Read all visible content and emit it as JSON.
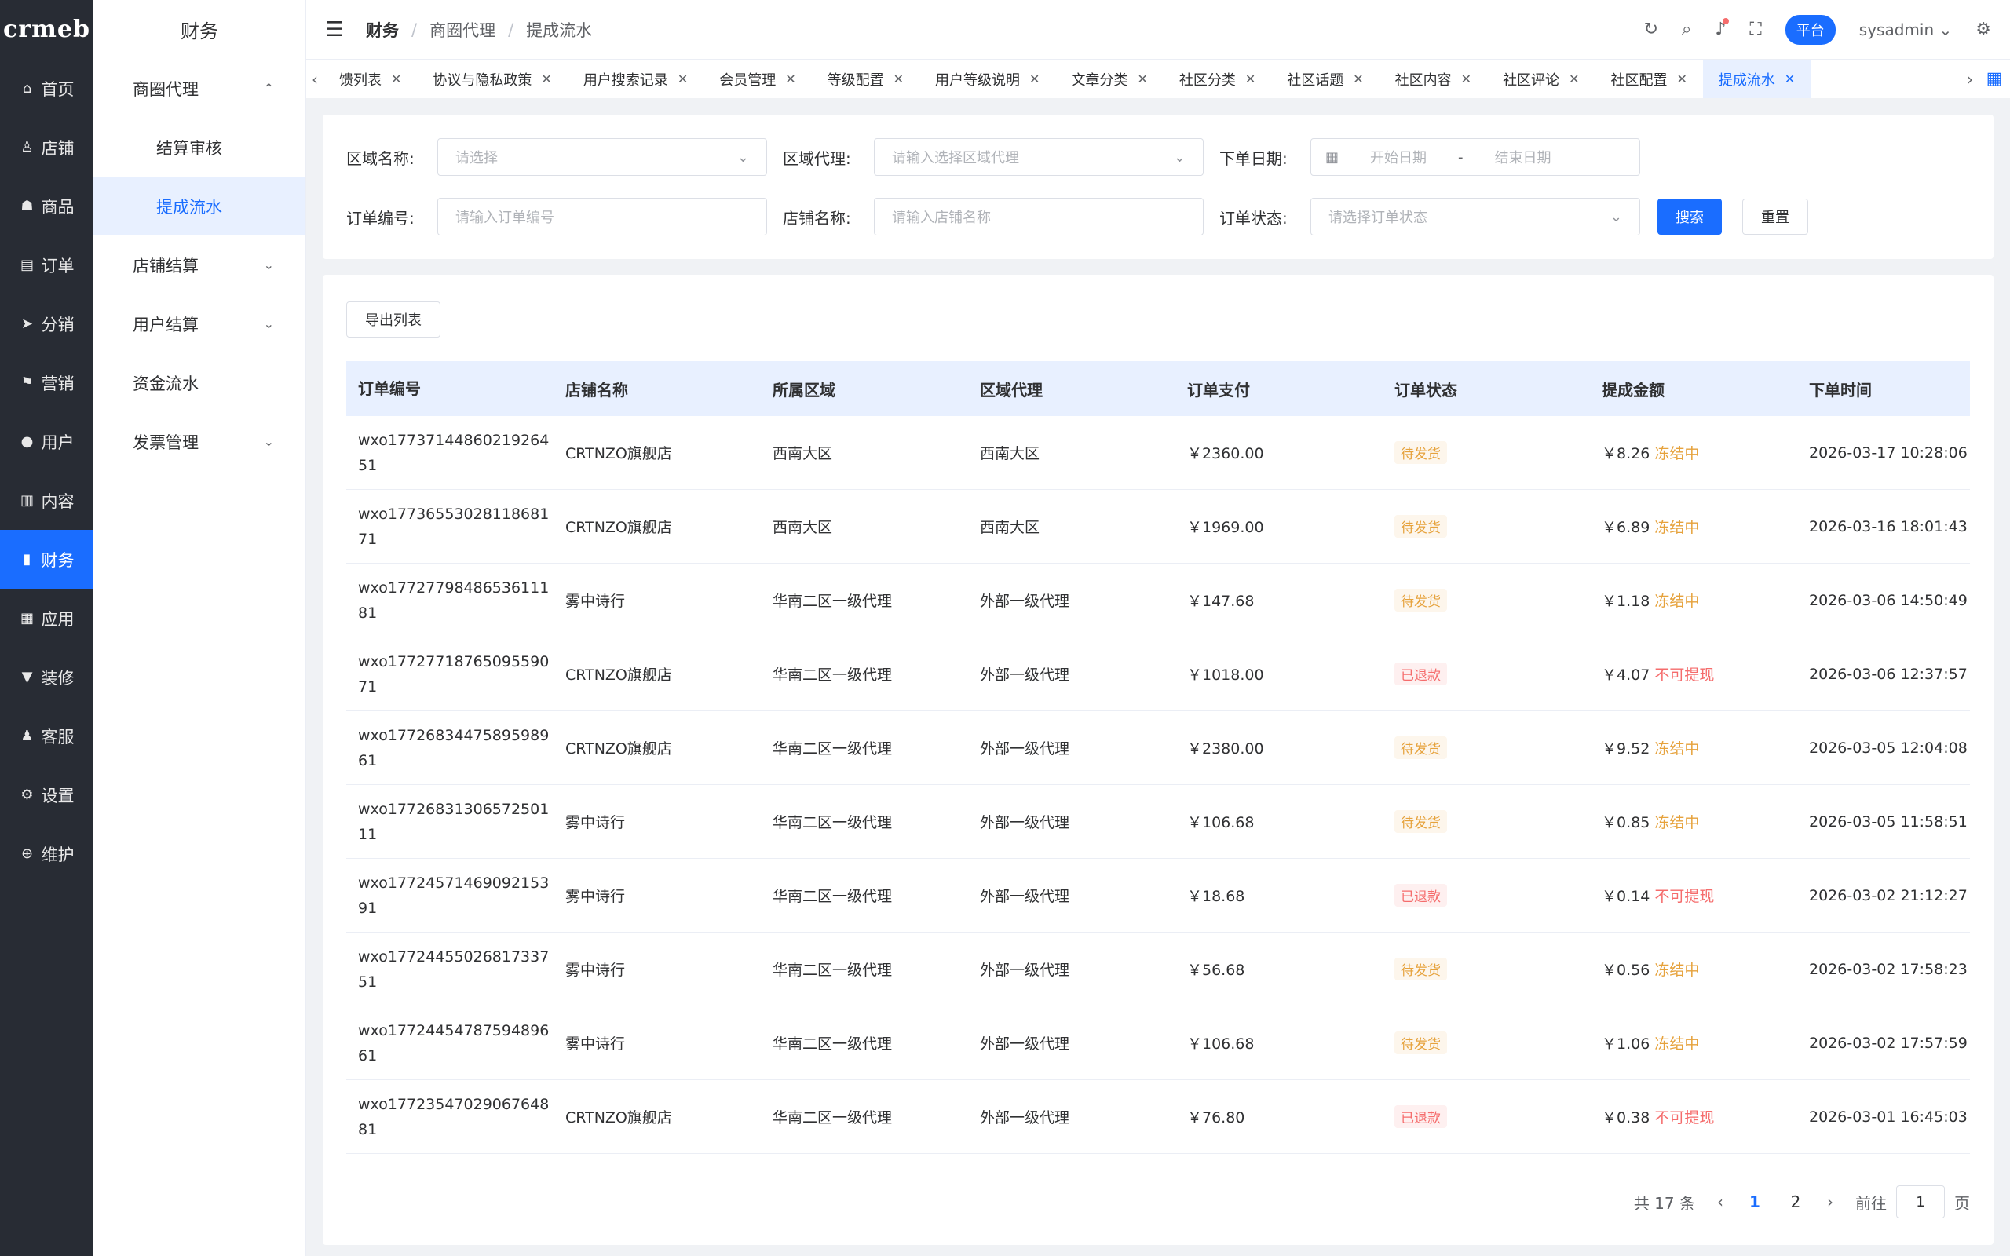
{
  "brand": {
    "logo": "crmeb"
  },
  "nav1": [
    {
      "icon": "⌂",
      "label": "首页"
    },
    {
      "icon": "♙",
      "label": "店铺"
    },
    {
      "icon": "☗",
      "label": "商品"
    },
    {
      "icon": "▤",
      "label": "订单"
    },
    {
      "icon": "➤",
      "label": "分销"
    },
    {
      "icon": "⚑",
      "label": "营销"
    },
    {
      "icon": "●",
      "label": "用户"
    },
    {
      "icon": "▥",
      "label": "内容"
    },
    {
      "icon": "▮",
      "label": "财务"
    },
    {
      "icon": "▦",
      "label": "应用"
    },
    {
      "icon": "▼",
      "label": "装修"
    },
    {
      "icon": "♟",
      "label": "客服"
    },
    {
      "icon": "⚙",
      "label": "设置"
    },
    {
      "icon": "⊕",
      "label": "维护"
    }
  ],
  "nav2": {
    "title": "财务",
    "items": [
      {
        "label": "商圈代理",
        "chev": "⌃"
      },
      {
        "label": "结算审核"
      },
      {
        "label": "提成流水"
      },
      {
        "label": "店铺结算",
        "chev": "⌄"
      },
      {
        "label": "用户结算",
        "chev": "⌄"
      },
      {
        "label": "资金流水"
      },
      {
        "label": "发票管理",
        "chev": "⌄"
      }
    ]
  },
  "header": {
    "breadcrumb": [
      "财务",
      "商圈代理",
      "提成流水"
    ],
    "separator": "/",
    "platform": "平台",
    "user": "sysadmin"
  },
  "tabs": [
    {
      "label": "馈列表"
    },
    {
      "label": "协议与隐私政策"
    },
    {
      "label": "用户搜索记录"
    },
    {
      "label": "会员管理"
    },
    {
      "label": "等级配置"
    },
    {
      "label": "用户等级说明"
    },
    {
      "label": "文章分类"
    },
    {
      "label": "社区分类"
    },
    {
      "label": "社区话题"
    },
    {
      "label": "社区内容"
    },
    {
      "label": "社区评论"
    },
    {
      "label": "社区配置"
    },
    {
      "label": "提成流水"
    }
  ],
  "filters": {
    "region_name": {
      "label": "区域名称:",
      "placeholder": "请选择"
    },
    "region_agent": {
      "label": "区域代理:",
      "placeholder": "请输入选择区域代理"
    },
    "order_date": {
      "label": "下单日期:",
      "start": "开始日期",
      "end": "结束日期",
      "dash": "-"
    },
    "order_no": {
      "label": "订单编号:",
      "placeholder": "请输入订单编号"
    },
    "store_name": {
      "label": "店铺名称:",
      "placeholder": "请输入店铺名称"
    },
    "order_status": {
      "label": "订单状态:",
      "placeholder": "请选择订单状态"
    },
    "search_btn": "搜索",
    "reset_btn": "重置"
  },
  "export_btn": "导出列表",
  "table": {
    "headers": [
      "订单编号",
      "店铺名称",
      "所属区域",
      "区域代理",
      "订单支付",
      "订单状态",
      "提成金额",
      "下单时间"
    ],
    "rows": [
      {
        "order": "wxo1773714486021926451",
        "store": "CRTNZO旗舰店",
        "area": "西南大区",
        "agent": "西南大区",
        "pay": "￥2360.00",
        "status": "待发货",
        "status_type": "wait",
        "amount": "￥8.26",
        "state": "冻结中",
        "state_type": "frozen",
        "time": "2026-03-17 10:28:06"
      },
      {
        "order": "wxo1773655302811868171",
        "store": "CRTNZO旗舰店",
        "area": "西南大区",
        "agent": "西南大区",
        "pay": "￥1969.00",
        "status": "待发货",
        "status_type": "wait",
        "amount": "￥6.89",
        "state": "冻结中",
        "state_type": "frozen",
        "time": "2026-03-16 18:01:43"
      },
      {
        "order": "wxo1772779848653611181",
        "store": "雾中诗行",
        "area": "华南二区一级代理",
        "agent": "外部一级代理",
        "pay": "￥147.68",
        "status": "待发货",
        "status_type": "wait",
        "amount": "￥1.18",
        "state": "冻结中",
        "state_type": "frozen",
        "time": "2026-03-06 14:50:49"
      },
      {
        "order": "wxo1772771876509559071",
        "store": "CRTNZO旗舰店",
        "area": "华南二区一级代理",
        "agent": "外部一级代理",
        "pay": "￥1018.00",
        "status": "已退款",
        "status_type": "refund",
        "amount": "￥4.07",
        "state": "不可提现",
        "state_type": "nowd",
        "time": "2026-03-06 12:37:57"
      },
      {
        "order": "wxo1772683447589598961",
        "store": "CRTNZO旗舰店",
        "area": "华南二区一级代理",
        "agent": "外部一级代理",
        "pay": "￥2380.00",
        "status": "待发货",
        "status_type": "wait",
        "amount": "￥9.52",
        "state": "冻结中",
        "state_type": "frozen",
        "time": "2026-03-05 12:04:08"
      },
      {
        "order": "wxo1772683130657250111",
        "store": "雾中诗行",
        "area": "华南二区一级代理",
        "agent": "外部一级代理",
        "pay": "￥106.68",
        "status": "待发货",
        "status_type": "wait",
        "amount": "￥0.85",
        "state": "冻结中",
        "state_type": "frozen",
        "time": "2026-03-05 11:58:51"
      },
      {
        "order": "wxo1772457146909215391",
        "store": "雾中诗行",
        "area": "华南二区一级代理",
        "agent": "外部一级代理",
        "pay": "￥18.68",
        "status": "已退款",
        "status_type": "refund",
        "amount": "￥0.14",
        "state": "不可提现",
        "state_type": "nowd",
        "time": "2026-03-02 21:12:27"
      },
      {
        "order": "wxo1772445502681733751",
        "store": "雾中诗行",
        "area": "华南二区一级代理",
        "agent": "外部一级代理",
        "pay": "￥56.68",
        "status": "待发货",
        "status_type": "wait",
        "amount": "￥0.56",
        "state": "冻结中",
        "state_type": "frozen",
        "time": "2026-03-02 17:58:23"
      },
      {
        "order": "wxo1772445478759489661",
        "store": "雾中诗行",
        "area": "华南二区一级代理",
        "agent": "外部一级代理",
        "pay": "￥106.68",
        "status": "待发货",
        "status_type": "wait",
        "amount": "￥1.06",
        "state": "冻结中",
        "state_type": "frozen",
        "time": "2026-03-02 17:57:59"
      },
      {
        "order": "wxo1772354702906764881",
        "store": "CRTNZO旗舰店",
        "area": "华南二区一级代理",
        "agent": "外部一级代理",
        "pay": "￥76.80",
        "status": "已退款",
        "status_type": "refund",
        "amount": "￥0.38",
        "state": "不可提现",
        "state_type": "nowd",
        "time": "2026-03-01 16:45:03"
      }
    ]
  },
  "pagination": {
    "total": "共 17 条",
    "pages": [
      "1",
      "2"
    ],
    "current": "1",
    "goto_prefix": "前往",
    "goto_value": "1",
    "goto_suffix": "页"
  },
  "colors": {
    "primary": "#1a6dff",
    "sidebar": "#282c34",
    "warning": "#e6a23c",
    "danger": "#f56c6c"
  }
}
